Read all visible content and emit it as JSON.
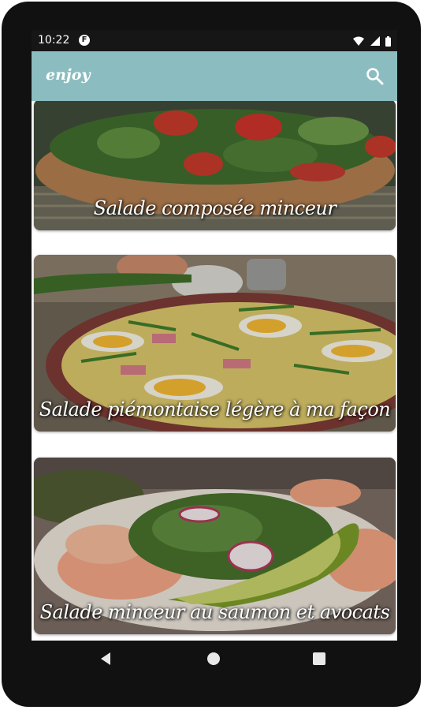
{
  "status_bar": {
    "time": "10:22",
    "notification_glyph": "F",
    "icons": [
      "wifi-icon",
      "cell-signal-icon",
      "battery-icon"
    ]
  },
  "app_bar": {
    "title": "enjoy",
    "search_icon": "search-icon",
    "background_color": "#8bbdc0"
  },
  "recipes": [
    {
      "title": "Salade composée minceur"
    },
    {
      "title": "Salade piémontaise légère à ma façon"
    },
    {
      "title": "Salade minceur au saumon et avocats"
    }
  ],
  "nav_bar": {
    "buttons": [
      "back-icon",
      "home-icon",
      "recents-icon"
    ]
  }
}
